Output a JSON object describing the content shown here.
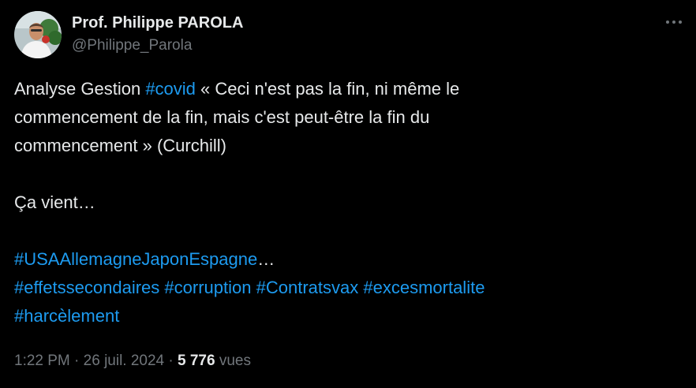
{
  "author": {
    "display_name": "Prof. Philippe PAROLA",
    "handle": "@Philippe_Parola",
    "avatar_icon": "profile-photo"
  },
  "more_icon": "ellipsis-icon",
  "tweet": {
    "line1_prefix": "Analyse Gestion ",
    "line1_hashtag": "#covid",
    "line1_suffix": " « Ceci n'est pas la fin, ni même le",
    "line2": "commencement de la fin, mais c'est peut-être la fin du",
    "line3": "commencement » (Curchill)",
    "line4": "Ça vient…",
    "hashtag_usa": "#USAAllemagneJaponEspagne",
    "ellipsis": "…",
    "hashtags_line": [
      "#effetssecondaires",
      "#corruption",
      "#Contratsvax",
      "#excesmortalite"
    ],
    "hashtag_last": "#harcèlement"
  },
  "meta": {
    "time": "1:22 PM",
    "separator": " · ",
    "date": "26 juil. 2024",
    "views_count": "5 776",
    "views_label": " vues"
  },
  "colors": {
    "background": "#000000",
    "text": "#e7e9ea",
    "secondary": "#71767b",
    "link": "#1d9bf0"
  }
}
